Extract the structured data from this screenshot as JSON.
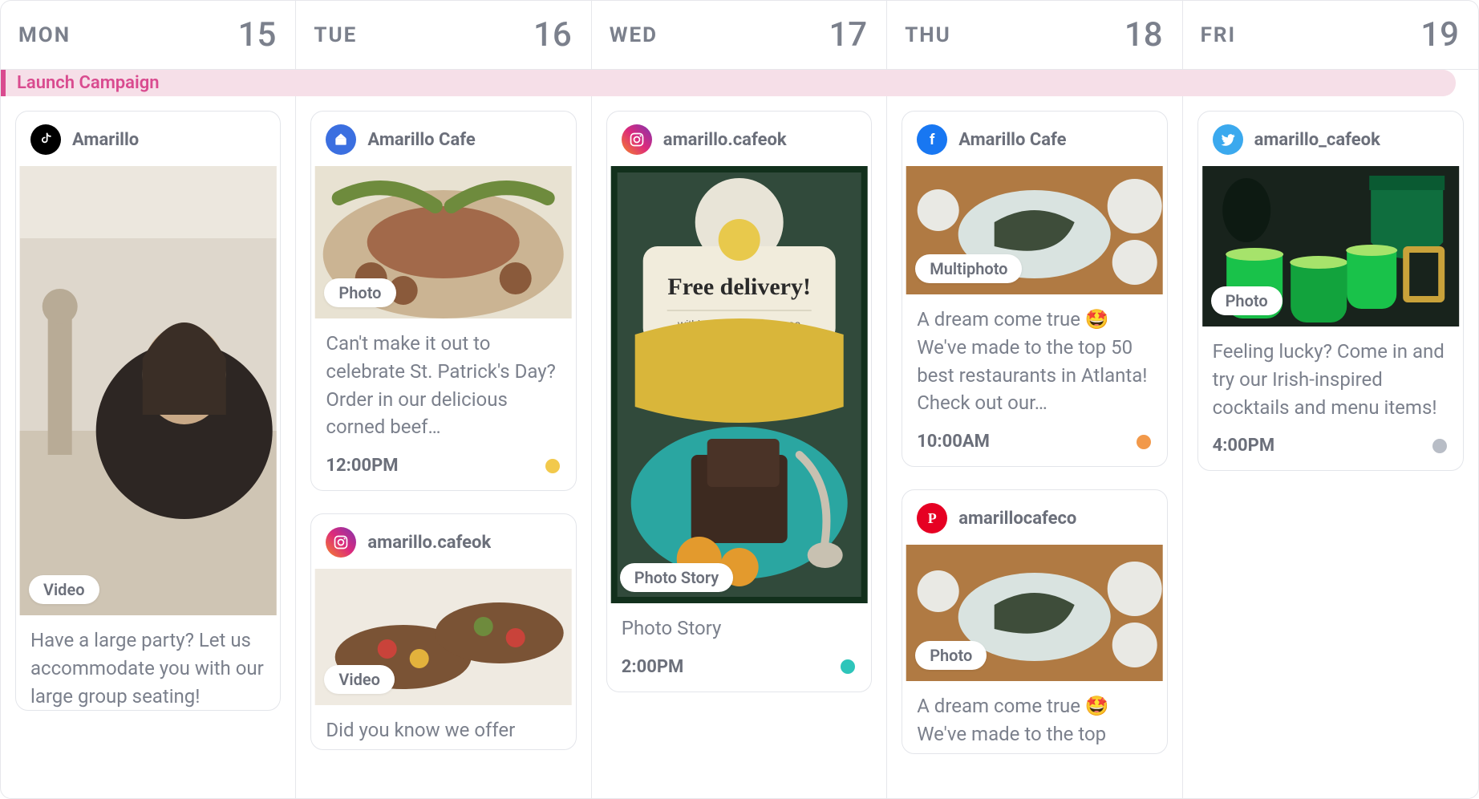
{
  "campaign": {
    "label": "Launch Campaign"
  },
  "days": [
    {
      "name": "MON",
      "num": "15"
    },
    {
      "name": "TUE",
      "num": "16"
    },
    {
      "name": "WED",
      "num": "17"
    },
    {
      "name": "THU",
      "num": "18"
    },
    {
      "name": "FRI",
      "num": "19"
    }
  ],
  "posts": {
    "mon": [
      {
        "platform": "tiktok",
        "account": "Amarillo",
        "media_type": "Video",
        "text": "Have a large party? Let us accommodate you with our large group seating!",
        "time": "",
        "status": ""
      }
    ],
    "tue": [
      {
        "platform": "google",
        "account": "Amarillo Cafe",
        "media_type": "Photo",
        "text": "Can't make it out to celebrate St. Patrick's Day? Order in our delicious corned beef…",
        "time": "12:00PM",
        "status": "yellow"
      },
      {
        "platform": "instagram",
        "account": "amarillo.cafeok",
        "media_type": "Video",
        "text": "Did you know we offer",
        "time": "",
        "status": ""
      }
    ],
    "wed": [
      {
        "platform": "instagram",
        "account": "amarillo.cafeok",
        "media_type": "Photo Story",
        "text": "Photo Story",
        "overlay_title": "Free delivery!",
        "overlay_sub": "within our coverage area",
        "time": "2:00PM",
        "status": "teal"
      }
    ],
    "thu": [
      {
        "platform": "facebook",
        "account": "Amarillo Cafe",
        "media_type": "Multiphoto",
        "text": "A dream come true 🤩 We've made to the top 50 best restaurants in Atlanta! Check out our…",
        "time": "10:00AM",
        "status": "orange"
      },
      {
        "platform": "pinterest",
        "account": "amarillocafeco",
        "media_type": "Photo",
        "text": "A dream come true 🤩 We've made to the top",
        "time": "",
        "status": ""
      }
    ],
    "fri": [
      {
        "platform": "twitter",
        "account": "amarillo_cafeok",
        "media_type": "Photo",
        "text": "Feeling lucky? Come in and try our Irish-inspired cocktails and menu items!",
        "time": "4:00PM",
        "status": "grey"
      }
    ]
  }
}
